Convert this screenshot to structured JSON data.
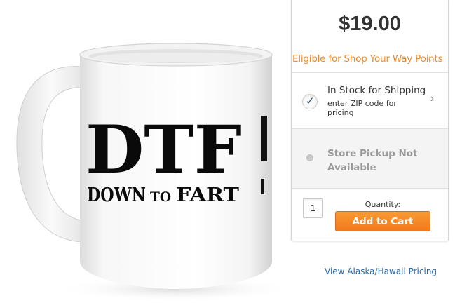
{
  "product_image": {
    "print_main": "DTF",
    "print_sub_left": "DOWN",
    "print_sub_mid": "TO",
    "print_sub_right": "FART"
  },
  "buy_box": {
    "price": "$19.00",
    "points_text": "Eligible for Shop Your Way Points",
    "shipping": {
      "title": "In Stock for Shipping",
      "subtitle": "enter ZIP code for pricing",
      "selected": true
    },
    "pickup": {
      "title": "Store Pickup Not Available"
    },
    "quantity_label": "Quantity:",
    "quantity_value": "1",
    "add_to_cart_label": "Add to Cart"
  },
  "links": {
    "alaska_hawaii": "View Alaska/Hawaii Pricing"
  },
  "colors": {
    "accent_orange": "#f38a2a",
    "link_blue": "#2d6aa3",
    "price_text": "#333333"
  },
  "icons": {
    "check": "checkmark-icon",
    "chevron": "chevron-right-icon"
  }
}
